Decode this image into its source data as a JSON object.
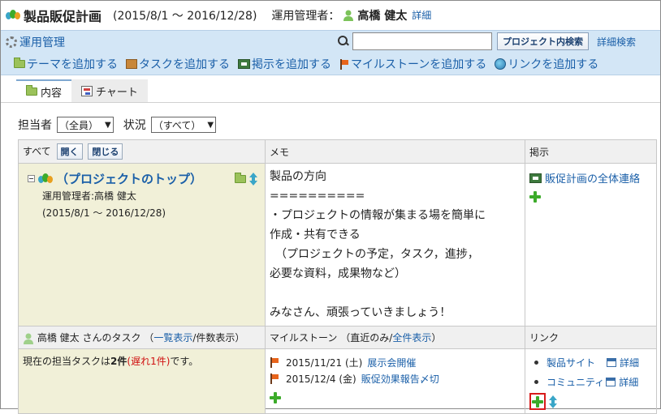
{
  "header": {
    "project_title": "製品販促計画",
    "period": "(2015/8/1 ～ 2016/12/28)",
    "manager_label": "運用管理者：",
    "manager_name": "高橋 健太",
    "detail_link": "詳細"
  },
  "toolbar": {
    "admin_link": "運用管理",
    "search": {
      "value": "",
      "placeholder": ""
    },
    "search_button": "プロジェクト内検索",
    "advanced_search": "詳細検索",
    "actions": [
      {
        "label": "テーマを追加する",
        "icon": "folder-icon"
      },
      {
        "label": "タスクを追加する",
        "icon": "box-icon"
      },
      {
        "label": "掲示を追加する",
        "icon": "board-icon"
      },
      {
        "label": "マイルストーンを追加する",
        "icon": "flag-icon"
      },
      {
        "label": "リンクを追加する",
        "icon": "globe-icon"
      }
    ]
  },
  "tabs": [
    {
      "label": "内容",
      "active": true,
      "icon": "folder-icon"
    },
    {
      "label": "チャート",
      "active": false,
      "icon": "chart-icon"
    }
  ],
  "filters": {
    "assignee_label": "担当者",
    "assignee_value": "（全員）",
    "status_label": "状況",
    "status_value": "（すべて）"
  },
  "table": {
    "col_all": "すべて",
    "open_button": "開く",
    "close_button": "閉じる",
    "col_memo": "メモ",
    "col_board": "掲示",
    "top": {
      "title": "（プロジェクトのトップ）",
      "manager": "運用管理者:高橋 健太",
      "period": "(2015/8/1 ～ 2016/12/28)"
    },
    "memo": "製品の方向\n==========\n・プロジェクトの情報が集まる場を簡単に\n作成・共有できる\n　（プロジェクトの予定，タスク，進捗，\n必要な資料，成果物など）\n\nみなさん、頑張っていきましょう！",
    "board_item": "販促計画の全体連絡",
    "task_header": {
      "user": "高橋 健太 さんのタスク",
      "list_view": "一覧表示",
      "count_view": "件数表示"
    },
    "milestone_header": {
      "label": "マイルストーン",
      "recent_only": "直近のみ",
      "show_all": "全件表示"
    },
    "link_header": "リンク",
    "task_status": {
      "prefix": "現在の担当タスクは",
      "count": "2件",
      "late_open": "(",
      "late": "遅れ1件",
      "late_close": ")",
      "suffix": "です。"
    },
    "milestones": [
      {
        "date": "2015/11/21 (土)",
        "title": "展示会開催"
      },
      {
        "date": "2015/12/4 (金)",
        "title": "販促効果報告〆切"
      }
    ],
    "links": [
      {
        "label": "製品サイト",
        "detail": "詳細"
      },
      {
        "label": "コミュニティ",
        "detail": "詳細"
      }
    ]
  },
  "colors": {
    "toolbar_bg": "#d3e6f6",
    "link": "#1a5fa8",
    "top_row_bg": "#f1f0d8",
    "late_red": "#d01010",
    "highlight_border": "#d81b1b"
  }
}
